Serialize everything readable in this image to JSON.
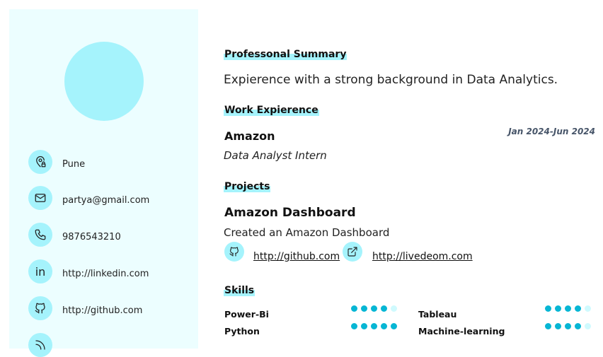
{
  "sidebar": {
    "contacts": [
      {
        "icon": "map-pin-icon",
        "text": "Pune"
      },
      {
        "icon": "mail-icon",
        "text": "partya@gmail.com"
      },
      {
        "icon": "phone-icon",
        "text": "9876543210"
      },
      {
        "icon": "linkedin-icon",
        "text": "http://linkedin.com"
      },
      {
        "icon": "github-icon",
        "text": "http://github.com"
      }
    ]
  },
  "summary": {
    "heading": "Professonal Summary",
    "text": "Expierence with a strong background in Data Analytics."
  },
  "work": {
    "heading": "Work Expierence",
    "company": "Amazon",
    "role": "Data Analyst Intern",
    "dates": "Jan 2024-Jun 2024"
  },
  "projects": {
    "heading": "Projects",
    "name": "Amazon Dashboard",
    "description": "Created an Amazon Dashboard",
    "github_link": "http://github.com",
    "live_link": "http://livedeom.com"
  },
  "skills": {
    "heading": "Skills",
    "items": [
      {
        "name": "Power-Bi",
        "level": 4,
        "max": 5
      },
      {
        "name": "Tableau",
        "level": 4,
        "max": 5
      },
      {
        "name": "Python",
        "level": 5,
        "max": 5
      },
      {
        "name": "Machine-learning",
        "level": 4,
        "max": 5
      }
    ]
  },
  "colors": {
    "sidebar_bg": "#ecfeff",
    "accent_light": "#a5f3fc",
    "accent": "#06b6d4"
  }
}
